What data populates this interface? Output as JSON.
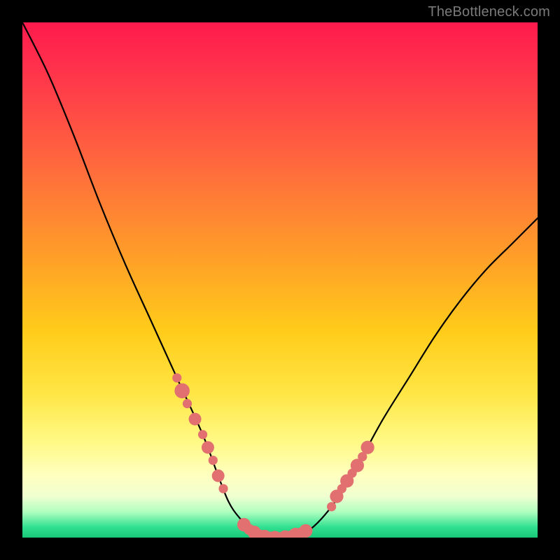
{
  "watermark": "TheBottleneck.com",
  "chart_data": {
    "type": "line",
    "title": "",
    "xlabel": "",
    "ylabel": "",
    "xlim": [
      0,
      100
    ],
    "ylim": [
      0,
      100
    ],
    "series": [
      {
        "name": "bottleneck-curve",
        "x": [
          0,
          5,
          10,
          15,
          20,
          25,
          30,
          35,
          38,
          40,
          42,
          45,
          47,
          50,
          55,
          60,
          65,
          70,
          75,
          80,
          85,
          90,
          95,
          100
        ],
        "y": [
          100,
          90,
          78,
          65,
          53,
          42,
          31,
          20,
          12,
          7,
          4,
          1,
          0,
          0,
          1,
          6,
          14,
          23,
          31,
          39,
          46,
          52,
          57,
          62
        ]
      }
    ],
    "markers": {
      "name": "highlight-points",
      "color": "#e27070",
      "points": [
        {
          "x": 30,
          "y": 31,
          "r": 1.1
        },
        {
          "x": 31,
          "y": 28.5,
          "r": 1.8
        },
        {
          "x": 32,
          "y": 26,
          "r": 1.1
        },
        {
          "x": 33.5,
          "y": 23,
          "r": 1.5
        },
        {
          "x": 35,
          "y": 20,
          "r": 1.1
        },
        {
          "x": 36,
          "y": 17.5,
          "r": 1.5
        },
        {
          "x": 37,
          "y": 15,
          "r": 1.1
        },
        {
          "x": 38,
          "y": 12,
          "r": 1.5
        },
        {
          "x": 39,
          "y": 9.5,
          "r": 1.1
        },
        {
          "x": 43,
          "y": 2.5,
          "r": 1.6
        },
        {
          "x": 44,
          "y": 1.6,
          "r": 1.3
        },
        {
          "x": 45,
          "y": 1.0,
          "r": 1.6
        },
        {
          "x": 46,
          "y": 0.5,
          "r": 1.3
        },
        {
          "x": 47,
          "y": 0.2,
          "r": 1.6
        },
        {
          "x": 48,
          "y": 0.1,
          "r": 1.3
        },
        {
          "x": 49,
          "y": 0.0,
          "r": 1.6
        },
        {
          "x": 50,
          "y": 0.0,
          "r": 1.3
        },
        {
          "x": 51,
          "y": 0.1,
          "r": 1.6
        },
        {
          "x": 52,
          "y": 0.3,
          "r": 1.3
        },
        {
          "x": 53,
          "y": 0.6,
          "r": 1.6
        },
        {
          "x": 54,
          "y": 0.9,
          "r": 1.3
        },
        {
          "x": 55,
          "y": 1.3,
          "r": 1.6
        },
        {
          "x": 60,
          "y": 6,
          "r": 1.1
        },
        {
          "x": 61,
          "y": 8,
          "r": 1.6
        },
        {
          "x": 62,
          "y": 9.5,
          "r": 1.1
        },
        {
          "x": 63,
          "y": 11,
          "r": 1.6
        },
        {
          "x": 64,
          "y": 12.5,
          "r": 1.1
        },
        {
          "x": 65,
          "y": 14,
          "r": 1.6
        },
        {
          "x": 66,
          "y": 15.7,
          "r": 1.1
        },
        {
          "x": 67,
          "y": 17.5,
          "r": 1.6
        }
      ]
    },
    "background_gradient": {
      "top": "#ff1a4d",
      "bottom": "#18c878"
    }
  }
}
